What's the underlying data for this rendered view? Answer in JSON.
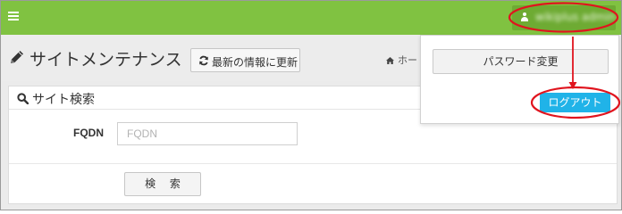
{
  "header": {
    "user_name": "wikiplus admin"
  },
  "title_bar": {
    "title": "サイトメンテナンス",
    "refresh_label": "最新の情報に更新",
    "breadcrumb_home": "ホー"
  },
  "search_panel": {
    "title": "サイト検索",
    "fqdn_label": "FQDN",
    "fqdn_placeholder": "FQDN",
    "fqdn_value": "",
    "search_button": "検 索"
  },
  "user_dropdown": {
    "change_password": "パスワード変更",
    "logout": "ログアウト"
  },
  "colors": {
    "topbar": "#80c241",
    "logout_button": "#20b3e8",
    "annotation": "#e0141e"
  },
  "icons": [
    "menu-icon",
    "user-icon",
    "pencil-icon",
    "refresh-icon",
    "home-icon",
    "search-icon"
  ]
}
